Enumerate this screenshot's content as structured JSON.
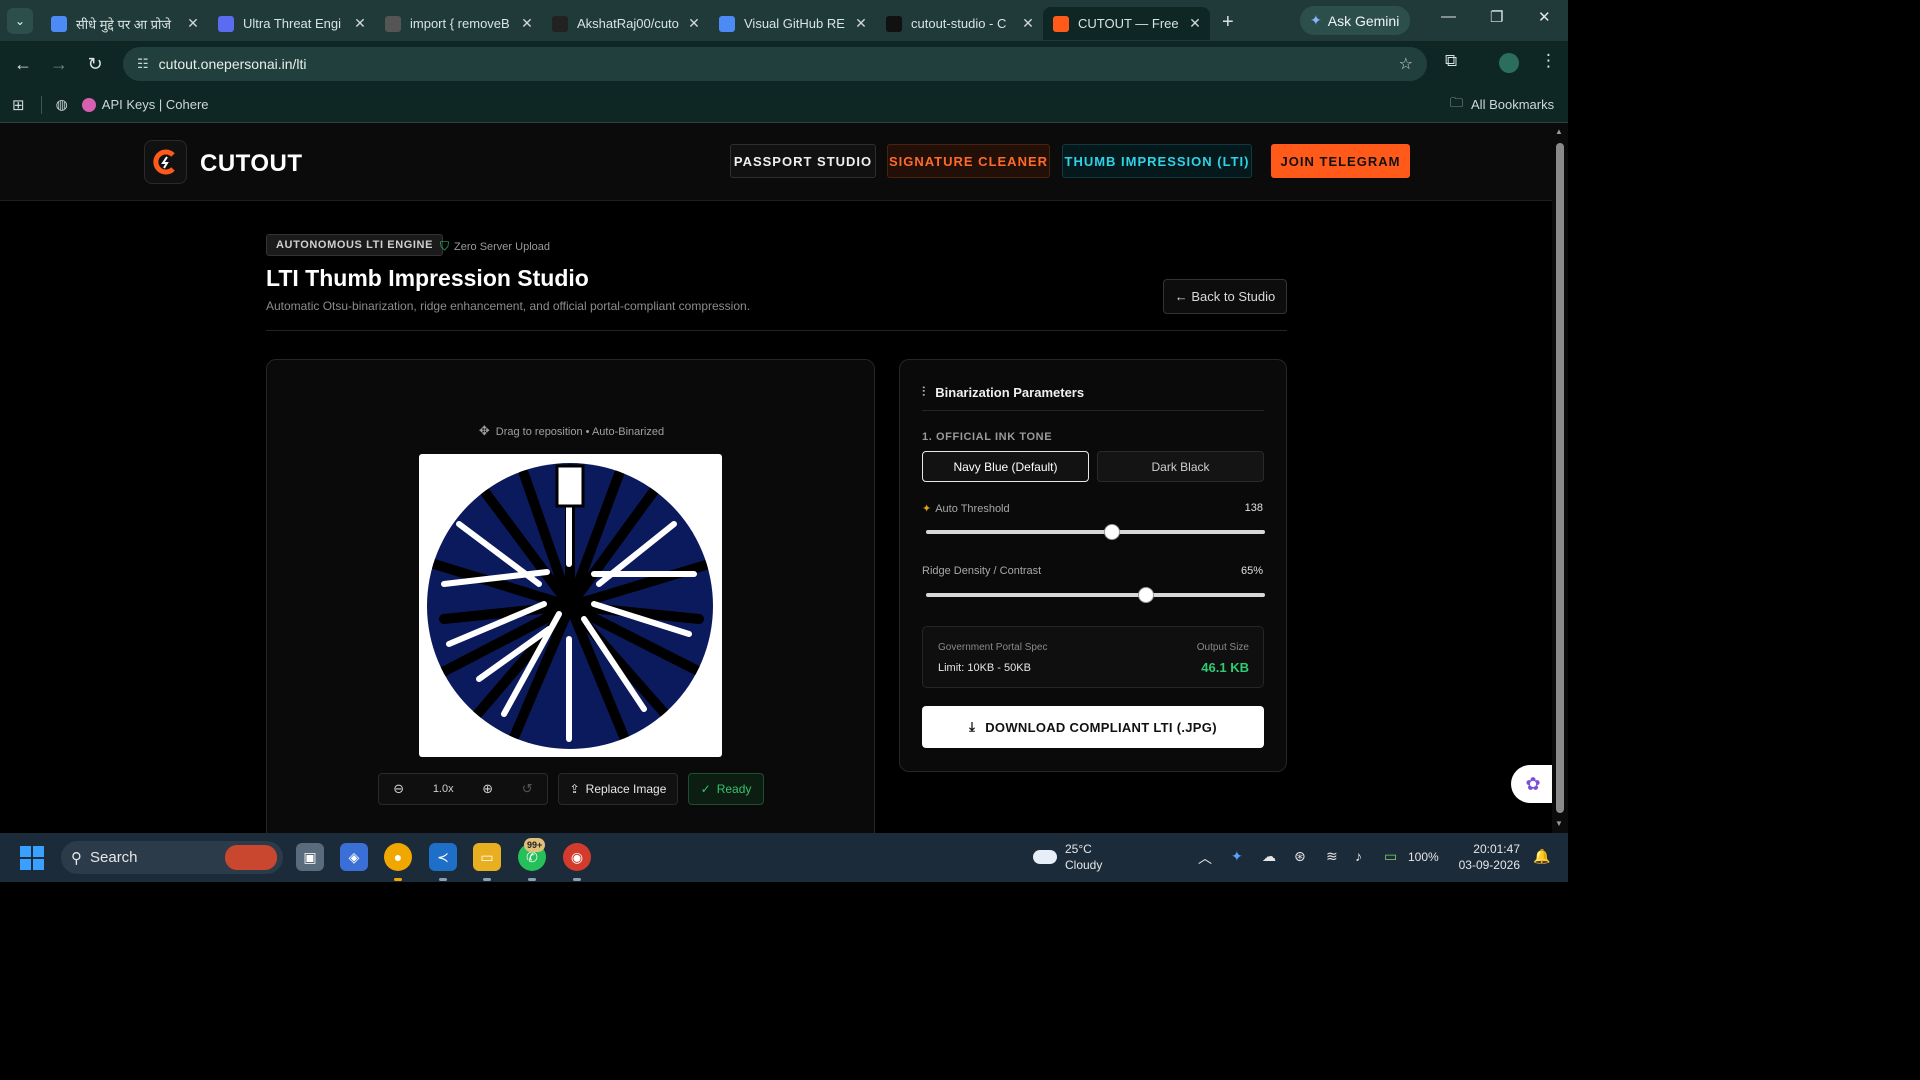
{
  "browser": {
    "tabs": [
      {
        "title": "सीधे मुद्दे पर आ प्रोजे",
        "icon": "gemini-icon",
        "color": "#4c8bf5"
      },
      {
        "title": "Ultra Threat Engi",
        "icon": "logo-icon",
        "color": "#5b6cf0"
      },
      {
        "title": "import { removeB",
        "icon": "generic-site-icon",
        "color": "#555555"
      },
      {
        "title": "AkshatRaj00/cuto",
        "icon": "github-icon",
        "color": "#222222"
      },
      {
        "title": "Visual GitHub RE",
        "icon": "gemini-icon",
        "color": "#4c8bf5"
      },
      {
        "title": "cutout-studio - C",
        "icon": "vercel-icon",
        "color": "#111111"
      },
      {
        "title": "CUTOUT — Free",
        "icon": "cutout-icon",
        "color": "#ff5a1a"
      }
    ],
    "ask_gemini": "Ask Gemini",
    "url": "cutout.onepersonai.in/lti",
    "bookmark_1": "API Keys | Cohere",
    "all_bookmarks": "All Bookmarks"
  },
  "header": {
    "logo_text": "CUTOUT",
    "nav": {
      "passport": "PASSPORT STUDIO",
      "signature": "SIGNATURE CLEANER",
      "thumb": "THUMB IMPRESSION (LTI)",
      "telegram": "JOIN TELEGRAM"
    }
  },
  "hero": {
    "badge": "AUTONOMOUS LTI ENGINE",
    "zero_upload": "Zero Server Upload",
    "title": "LTI Thumb Impression Studio",
    "subtitle": "Automatic Otsu-binarization, ridge enhancement, and official portal-compliant compression.",
    "back": "← Back to Studio"
  },
  "preview": {
    "hint": "Drag to reposition • Auto-Binarized",
    "zoom": "1.0x",
    "replace": "Replace Image",
    "status": "Ready"
  },
  "params": {
    "heading": "Binarization Parameters",
    "ink_label": "1. OFFICIAL INK TONE",
    "tone_navy": "Navy Blue (Default)",
    "tone_black": "Dark Black",
    "threshold_label": "Auto Threshold",
    "threshold_value": "138",
    "threshold_fraction": 0.55,
    "ridge_label": "Ridge Density / Contrast",
    "ridge_value": "65%",
    "ridge_fraction": 0.65,
    "spec_title": "Government Portal Spec",
    "spec_limit": "Limit: 10KB - 50KB",
    "output_title": "Output Size",
    "output_value": "46.1 KB",
    "download": "DOWNLOAD COMPLIANT LTI (.JPG)"
  },
  "taskbar": {
    "search": "Search",
    "wa_badge": "99+",
    "temp": "25°C",
    "weather": "Cloudy",
    "battery": "100%",
    "time": "20:01:47",
    "date": "03-09-2026"
  },
  "colors": {
    "accent": "#ff5a1a",
    "ink": "#0b1a5c",
    "success": "#2ecc71"
  }
}
